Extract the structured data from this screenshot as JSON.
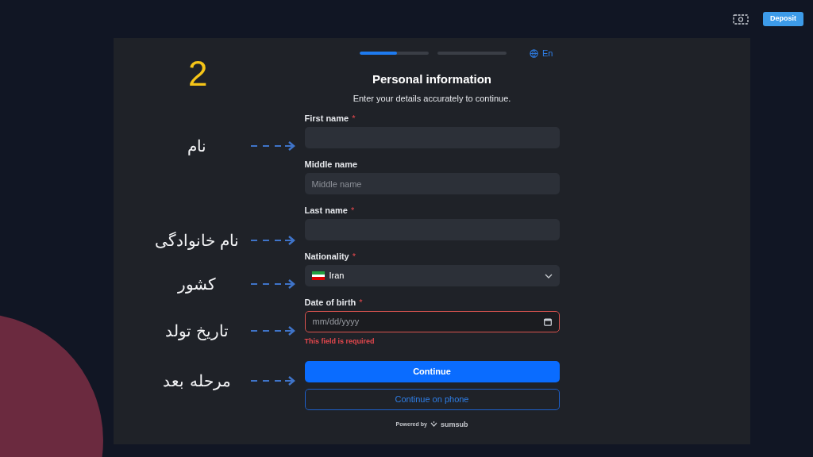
{
  "header": {
    "deposit_button": "Deposit"
  },
  "steps": [
    {
      "level": 0.55
    },
    {
      "level": 0
    }
  ],
  "language": "En",
  "required_symbol": "*",
  "step_number": "2",
  "title": "Personal information",
  "subtitle": "Enter your details accurately to continue.",
  "fields": [
    {
      "kind": "text",
      "label": "First name",
      "required": true,
      "error": false
    },
    {
      "kind": "text",
      "label": "Middle name",
      "required": false,
      "placeholder": "Middle name",
      "error": false
    },
    {
      "kind": "text",
      "label": "Last name",
      "required": true,
      "error": false
    },
    {
      "kind": "select",
      "label": "Nationality",
      "required": true,
      "value": "Iran",
      "error": false
    },
    {
      "kind": "date",
      "label": "Date of birth",
      "required": true,
      "placeholder": "mm/dd/yyyy",
      "error": true,
      "error_text": "This field is required"
    }
  ],
  "buttons": [
    {
      "kind": "primary",
      "label": "Continue"
    },
    {
      "kind": "outline",
      "label": "Continue on phone"
    }
  ],
  "footer": {
    "powered_by": "Powered by",
    "brand": "sumsub"
  },
  "annotations": [
    {
      "text": "نام"
    },
    {
      "text": "نام خانوادگی"
    },
    {
      "text": "کشور"
    },
    {
      "text": "تاریخ تولد"
    },
    {
      "text": "مرحله بعد"
    }
  ]
}
